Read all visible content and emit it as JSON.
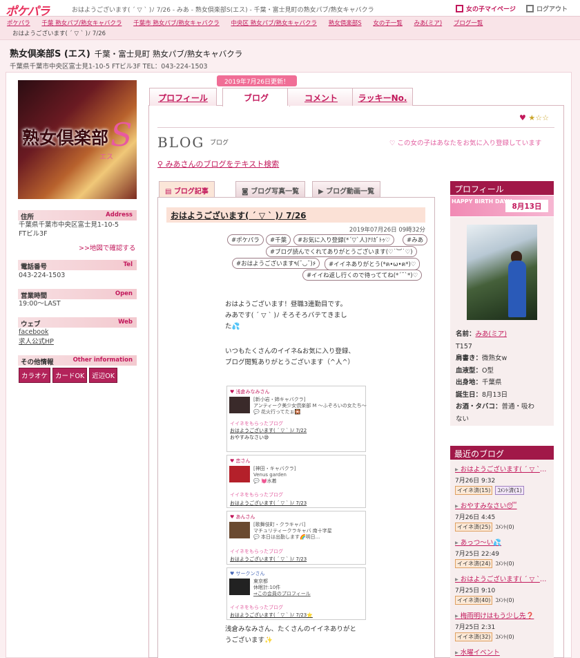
{
  "site": {
    "logo": "ポケパラ",
    "title": "おはようございます( ´ ▽ ` )ﾉ 7/26 - みあ - 熟女倶楽部S(エス) - 千葉・富士見町の熟女パブ/熟女キャバクラ",
    "mypage": "女の子マイページ",
    "logout": "ログアウト"
  },
  "breadcrumbs": [
    "ポケパラ",
    "千葉 熟女パブ/熟女キャバクラ",
    "千葉市 熟女パブ/熟女キャバクラ",
    "中央区 熟女パブ/熟女キャバクラ",
    "熟女倶楽部S",
    "女の子一覧",
    "みあ(ミア)",
    "ブログ一覧"
  ],
  "breadcrumb_current": "おはようございます( ´ ▽ ` )ﾉ 7/26",
  "shop": {
    "name": "熟女倶楽部S (エス)",
    "genre": "千葉・富士見町 熟女パブ/熟女キャバクラ",
    "address_line": "千葉県千葉市中央区富士見1-10-5 FTビル3F TEL：043-224-1503",
    "logo_text": "熟女倶楽部",
    "logo_s": "S",
    "logo_es": "エス"
  },
  "sidebar": {
    "address": {
      "label": "住所",
      "en": "Address",
      "value1": "千葉県千葉市中央区富士見1-10-5",
      "value2": "FTビル3F",
      "map": ">>地図で確認する"
    },
    "tel": {
      "label": "電話番号",
      "en": "Tel",
      "value": "043-224-1503"
    },
    "hours": {
      "label": "営業時間",
      "en": "Open",
      "value": "19:00〜LAST"
    },
    "web": {
      "label": "ウェブ",
      "en": "Web",
      "links": [
        "facebook",
        "求人公式HP"
      ]
    },
    "other": {
      "label": "その他情報",
      "en": "Other information",
      "tags": [
        "カラオケ",
        "カードOK",
        "近辺OK"
      ]
    }
  },
  "tabs": {
    "updated": "2019年7月26日更新！",
    "items": [
      "プロフィール",
      "ブログ",
      "コメント",
      "ラッキーNo."
    ]
  },
  "rating": {
    "heart": "♥",
    "stars": "★☆☆"
  },
  "blog": {
    "title": "BLOG",
    "subtitle": "ブログ",
    "fav_note": "この女の子はあなたをお気に入り登録しています",
    "search": "みあさんのブログをテキスト検索",
    "subtabs": [
      "ブログ記事",
      "ブログ写真一覧",
      "ブログ動画一覧"
    ],
    "post_title": "おはようございます( ´ ▽ ` )ﾉ 7/26",
    "post_date": "2019年07月26日 09時32分",
    "hashtags": [
      "#ポケパラ",
      "#千葉",
      "#お気に入り登録(*´▽`人)ｱﾘｶﾞﾄｩ♡",
      "#みあ",
      "#ブログ読んでくれてありがとうございます(♡˙︶˙♡)",
      "#おはようございます٩(˘◡˘)۶",
      "#イイネありがとう(*ฅ•ω•ฅ*)♡",
      "#イイね返し行くので待っててね(*´˘`*)♡"
    ],
    "body1": [
      "おはようございます！昼職3連勤目です。",
      "みあです( ´ ▽ ` )ﾉ そろそろバテてきまし",
      "た💦"
    ],
    "body2": [
      "いつもたくさんのイイネ&お気に入り登録、",
      "ブログ閲覧ありがとうございます（^人^）"
    ],
    "body3": [
      "浅倉みなみさん、たくさんのイイネありがと",
      "うございます✨"
    ],
    "comments": [
      {
        "name": "浅倉みなみさん",
        "desc1": "[新小岩・姉キャバクラ]",
        "desc2": "アンティーク美少女倶楽部 M ～ふぞろいの女たち～",
        "desc3": "💬 花火行ってたぉ🎇",
        "liked": "イイネをもらったブログ",
        "post1": "おはようございます( ´ ▽ ` )ﾉ 7/22",
        "post2": "おやすみなさい😪"
      },
      {
        "name": "恋さん",
        "desc1": "[神田・キャバクラ]",
        "desc2": "Venus garden",
        "desc3": "💬 💓水着",
        "liked": "イイネをもらったブログ",
        "post1": "おはようございます( ´ ▽ ` )ﾉ 7/23",
        "post2": ""
      },
      {
        "name": "あんさん",
        "desc1": "[歌舞伎町・クラキャバ]",
        "desc2": "マチュリティークラキャバ 南十字星",
        "desc3": "💬 本日は出勤します🌈明日...",
        "liked": "イイネをもらったブログ",
        "post1": "おはようございます( ´ ▽ ` )ﾉ 7/23",
        "post2": ""
      },
      {
        "name": "サークンさん",
        "desc1": "東京都",
        "desc2": "休眠計:10件",
        "desc3": "⇒この会員のプロフィール",
        "liked": "イイネをもらったブログ",
        "post1": "おはようございます( ´ ▽ ` )ﾉ 7/23⭐",
        "post2": ""
      }
    ]
  },
  "profile": {
    "header": "プロフィール",
    "bday_banner": "HAPPY BIRTH DAY!!",
    "bday_date": "8月13日",
    "rows": [
      [
        "名前：",
        "みあ(ミア)"
      ],
      [
        "",
        "T157"
      ],
      [
        "肩書き：",
        "微熟女w"
      ],
      [
        "血液型：",
        "O型"
      ],
      [
        "出身地：",
        "千葉県"
      ],
      [
        "誕生日：",
        "8月13日"
      ],
      [
        "お酒・タバコ：",
        "普通・吸わ"
      ],
      [
        "",
        "ない"
      ]
    ]
  },
  "recent": {
    "header": "最近のブログ",
    "items": [
      {
        "title": "おはようございます( ´ ▽ ` )ﾉ 7/26",
        "date": "7月26日 9:32",
        "likes": "イイネ済(15)",
        "comments": "ｺﾒﾝﾄ済(1)"
      },
      {
        "title": "おやすみなさい😴",
        "date": "7月26日 4:45",
        "likes": "イイネ済(25)",
        "comments": "ｺﾒﾝﾄ(0)"
      },
      {
        "title": "あっつ〜い💦",
        "date": "7月25日 22:49",
        "likes": "イイネ済(24)",
        "comments": "ｺﾒﾝﾄ(0)"
      },
      {
        "title": "おはようございます( ´ ▽ ` )ﾉ 7/25",
        "date": "7月25日 9:10",
        "likes": "イイネ済(40)",
        "comments": "ｺﾒﾝﾄ(0)"
      },
      {
        "title": "梅雨明けはもう少し先❓",
        "date": "7月25日 2:31",
        "likes": "イイネ済(32)",
        "comments": "ｺﾒﾝﾄ(0)"
      },
      {
        "title": "水曜イベント",
        "date": "",
        "likes": "",
        "comments": ""
      }
    ]
  }
}
